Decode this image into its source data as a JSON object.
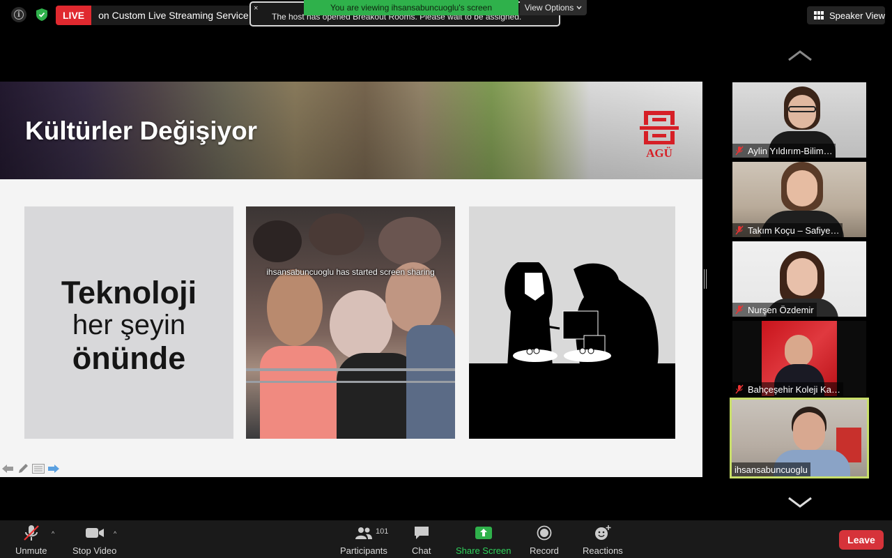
{
  "topbar": {
    "live_badge": "LIVE",
    "live_text": "on Custom Live Streaming Service",
    "notice_text": "The host has opened Breakout Rooms. Please wait to be assigned.",
    "notice_close": "×",
    "viewing_banner": "You are viewing ihsansabuncuoglu's screen",
    "view_options": "View Options",
    "speaker_view": "Speaker View"
  },
  "slide": {
    "title": "Kültürler Değişiyor",
    "logo_text": "AGÜ",
    "tile_lines": [
      "Teknoloji",
      "her şeyin",
      "önünde"
    ],
    "sharing_toast": "ihsansabuncuoglu has started screen sharing"
  },
  "gallery": {
    "participants": [
      {
        "name": "Aylin Yıldırım-Bilim…",
        "muted": true
      },
      {
        "name": "Takım Koçu – Safiye…",
        "muted": true
      },
      {
        "name": "Nurşen Özdemir",
        "muted": true
      },
      {
        "name": "Bahçeşehir Koleji Ka…",
        "muted": true
      },
      {
        "name": "ihsansabuncuoglu",
        "muted": false,
        "active": true
      }
    ]
  },
  "toolbar": {
    "unmute": "Unmute",
    "stop_video": "Stop Video",
    "participants": "Participants",
    "participants_count": "101",
    "chat": "Chat",
    "share_screen": "Share Screen",
    "record": "Record",
    "reactions": "Reactions",
    "leave": "Leave"
  },
  "colors": {
    "live_red": "#e0292f",
    "share_green": "#2fb14b",
    "leave_red": "#d6333a",
    "active_speaker_border": "#c9df6a"
  }
}
